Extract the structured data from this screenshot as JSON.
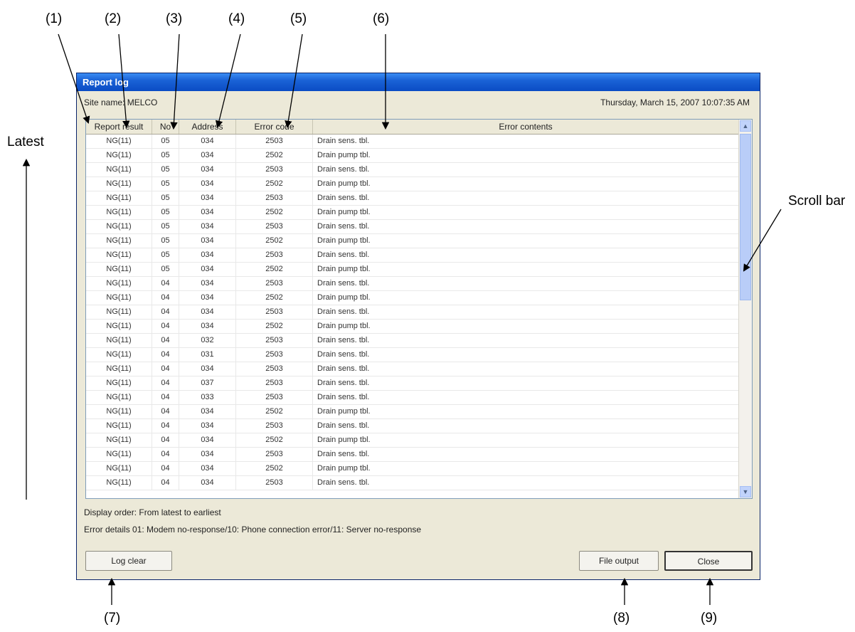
{
  "callouts": [
    "(1)",
    "(2)",
    "(3)",
    "(4)",
    "(5)",
    "(6)",
    "(7)",
    "(8)",
    "(9)"
  ],
  "labels": {
    "latest": "Latest",
    "scroll_bar": "Scroll bar"
  },
  "window": {
    "title": "Report log",
    "site_name": "Site name: MELCO",
    "datetime": "Thursday, March 15, 2007 10:07:35 AM",
    "columns": [
      "Report result",
      "No",
      "Address",
      "Error code",
      "Error contents"
    ],
    "rows": [
      [
        "NG(11)",
        "05",
        "034",
        "2503",
        "Drain sens. tbl."
      ],
      [
        "NG(11)",
        "05",
        "034",
        "2502",
        "Drain pump tbl."
      ],
      [
        "NG(11)",
        "05",
        "034",
        "2503",
        "Drain sens. tbl."
      ],
      [
        "NG(11)",
        "05",
        "034",
        "2502",
        "Drain pump tbl."
      ],
      [
        "NG(11)",
        "05",
        "034",
        "2503",
        "Drain sens. tbl."
      ],
      [
        "NG(11)",
        "05",
        "034",
        "2502",
        "Drain pump tbl."
      ],
      [
        "NG(11)",
        "05",
        "034",
        "2503",
        "Drain sens. tbl."
      ],
      [
        "NG(11)",
        "05",
        "034",
        "2502",
        "Drain pump tbl."
      ],
      [
        "NG(11)",
        "05",
        "034",
        "2503",
        "Drain sens. tbl."
      ],
      [
        "NG(11)",
        "05",
        "034",
        "2502",
        "Drain pump tbl."
      ],
      [
        "NG(11)",
        "04",
        "034",
        "2503",
        "Drain sens. tbl."
      ],
      [
        "NG(11)",
        "04",
        "034",
        "2502",
        "Drain pump tbl."
      ],
      [
        "NG(11)",
        "04",
        "034",
        "2503",
        "Drain sens. tbl."
      ],
      [
        "NG(11)",
        "04",
        "034",
        "2502",
        "Drain pump tbl."
      ],
      [
        "NG(11)",
        "04",
        "032",
        "2503",
        "Drain sens. tbl."
      ],
      [
        "NG(11)",
        "04",
        "031",
        "2503",
        "Drain sens. tbl."
      ],
      [
        "NG(11)",
        "04",
        "034",
        "2503",
        "Drain sens. tbl."
      ],
      [
        "NG(11)",
        "04",
        "037",
        "2503",
        "Drain sens. tbl."
      ],
      [
        "NG(11)",
        "04",
        "033",
        "2503",
        "Drain sens. tbl."
      ],
      [
        "NG(11)",
        "04",
        "034",
        "2502",
        "Drain pump tbl."
      ],
      [
        "NG(11)",
        "04",
        "034",
        "2503",
        "Drain sens. tbl."
      ],
      [
        "NG(11)",
        "04",
        "034",
        "2502",
        "Drain pump tbl."
      ],
      [
        "NG(11)",
        "04",
        "034",
        "2503",
        "Drain sens. tbl."
      ],
      [
        "NG(11)",
        "04",
        "034",
        "2502",
        "Drain pump tbl."
      ],
      [
        "NG(11)",
        "04",
        "034",
        "2503",
        "Drain sens. tbl."
      ]
    ],
    "display_order": "Display order: From latest to earliest",
    "error_details": "Error details 01: Modem no-response/10: Phone connection error/11: Server no-response",
    "buttons": {
      "log_clear": "Log clear",
      "file_output": "File output",
      "close": "Close"
    }
  }
}
